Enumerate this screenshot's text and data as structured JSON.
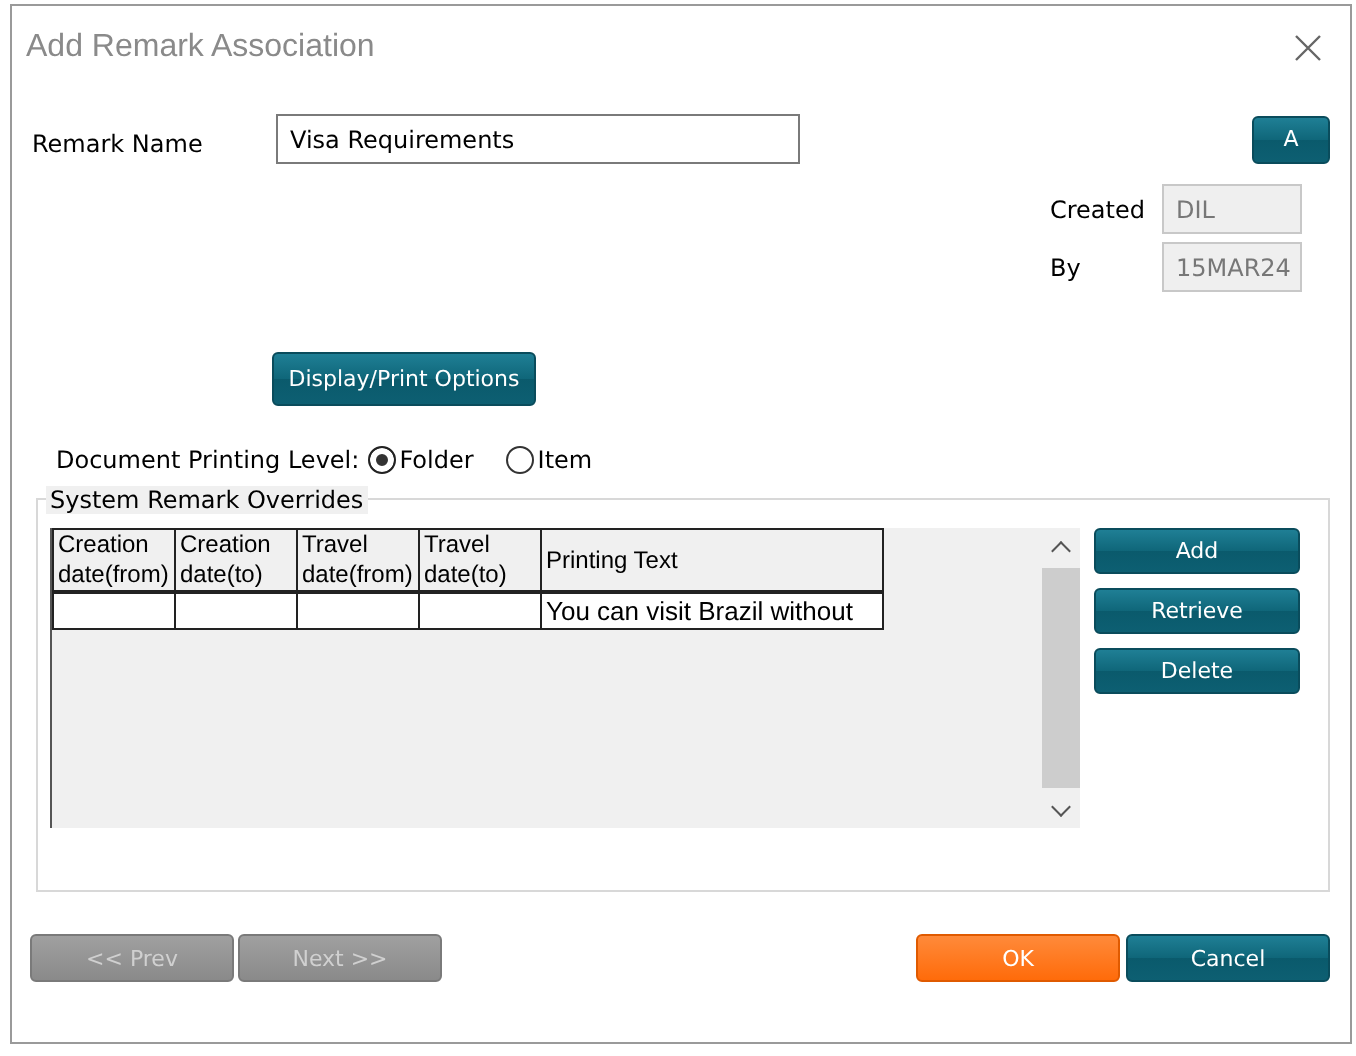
{
  "window": {
    "title": "Add Remark Association"
  },
  "remark_name": {
    "label": "Remark Name",
    "value": "Visa Requirements"
  },
  "a_button": {
    "label": "A"
  },
  "created": {
    "label": "Created",
    "value": "DIL"
  },
  "by": {
    "label": "By",
    "value": "15MAR24"
  },
  "display_print_button": {
    "label": "Display/Print Options"
  },
  "printing_level": {
    "label": "Document Printing Level:",
    "options": [
      {
        "label": "Folder",
        "selected": true
      },
      {
        "label": "Item",
        "selected": false
      }
    ]
  },
  "overrides": {
    "title": "System Remark Overrides",
    "table": {
      "columns": [
        "Creation date(from)",
        "Creation date(to)",
        "Travel date(from)",
        "Travel date(to)",
        "Printing Text"
      ],
      "rows": [
        [
          "",
          "",
          "",
          "",
          "You can visit Brazil without"
        ]
      ]
    },
    "buttons": [
      {
        "label": "Add"
      },
      {
        "label": "Retrieve"
      },
      {
        "label": "Delete"
      }
    ]
  },
  "footer_buttons": [
    {
      "label": "<< Prev",
      "kind": "nav",
      "disabled": true
    },
    {
      "label": "Next >>",
      "kind": "nav",
      "disabled": true
    },
    {
      "label": "OK",
      "kind": "primary",
      "disabled": false
    },
    {
      "label": "Cancel",
      "kind": "normal",
      "disabled": false
    }
  ]
}
